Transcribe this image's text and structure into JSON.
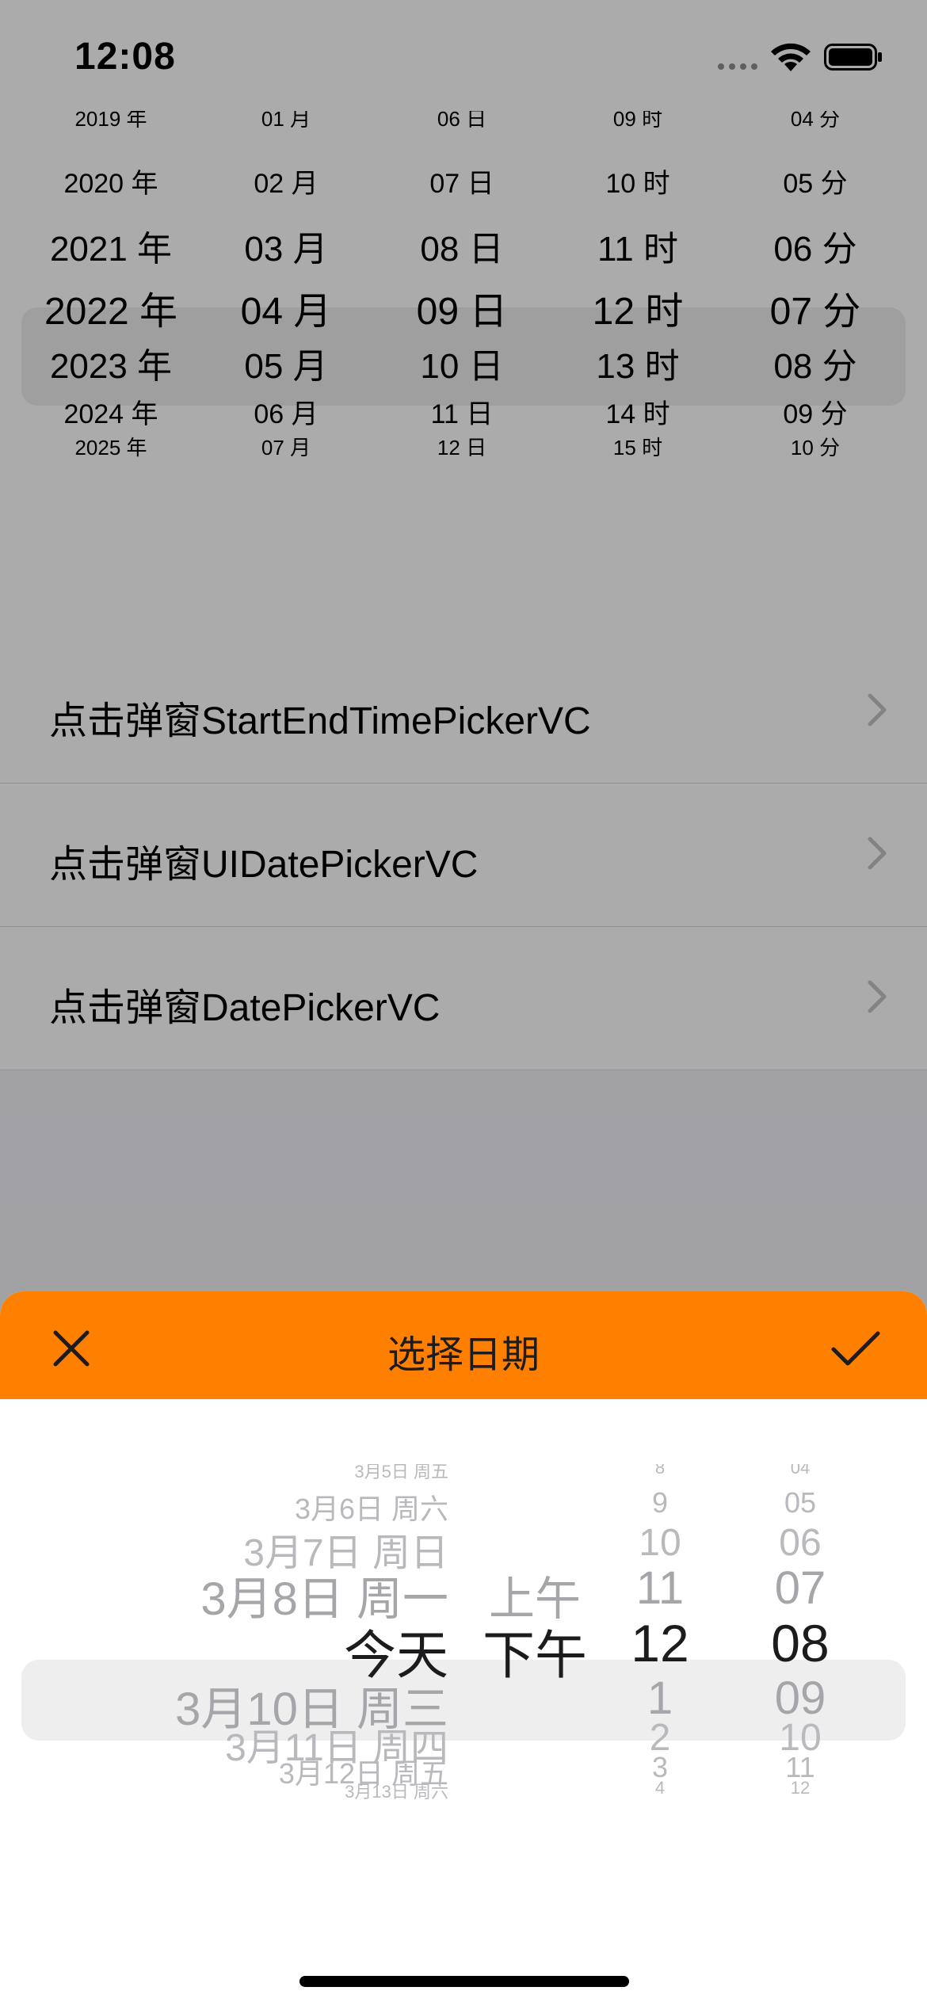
{
  "status_bar": {
    "time": "12:08"
  },
  "top_picker": {
    "columns": [
      {
        "name": "year",
        "items": [
          "2019 年",
          "2020 年",
          "2021 年",
          "2022 年",
          "2023 年",
          "2024 年",
          "2025 年"
        ]
      },
      {
        "name": "month",
        "items": [
          "01 月",
          "02 月",
          "03 月",
          "04 月",
          "05 月",
          "06 月",
          "07 月"
        ]
      },
      {
        "name": "day",
        "items": [
          "06 日",
          "07 日",
          "08 日",
          "09 日",
          "10 日",
          "11 日",
          "12 日"
        ]
      },
      {
        "name": "hour",
        "items": [
          "09 时",
          "10 时",
          "11 时",
          "12 时",
          "13 时",
          "14 时",
          "15 时"
        ]
      },
      {
        "name": "minute",
        "items": [
          "04 分",
          "05 分",
          "06 分",
          "07 分",
          "08 分",
          "09 分",
          "10 分"
        ]
      }
    ]
  },
  "menu": {
    "items": [
      {
        "label": "点击弹窗StartEndTimePickerVC"
      },
      {
        "label": "点击弹窗UIDatePickerVC"
      },
      {
        "label": "点击弹窗DatePickerVC"
      }
    ]
  },
  "sheet": {
    "title": "选择日期",
    "header_color": "#ff7f00",
    "close_icon": "close-icon",
    "confirm_icon": "checkmark-icon",
    "wheel": {
      "date": [
        "3月5日 周五",
        "3月6日 周六",
        "3月7日 周日",
        "3月8日 周一",
        "今天",
        "3月10日 周三",
        "3月11日 周四",
        "3月12日 周五",
        "3月13日 周六"
      ],
      "ampm": [
        "上午",
        "下午"
      ],
      "hour": [
        "8",
        "9",
        "10",
        "11",
        "12",
        "1",
        "2",
        "3",
        "4"
      ],
      "minute": [
        "04",
        "05",
        "06",
        "07",
        "08",
        "09",
        "10",
        "11",
        "12"
      ]
    }
  }
}
